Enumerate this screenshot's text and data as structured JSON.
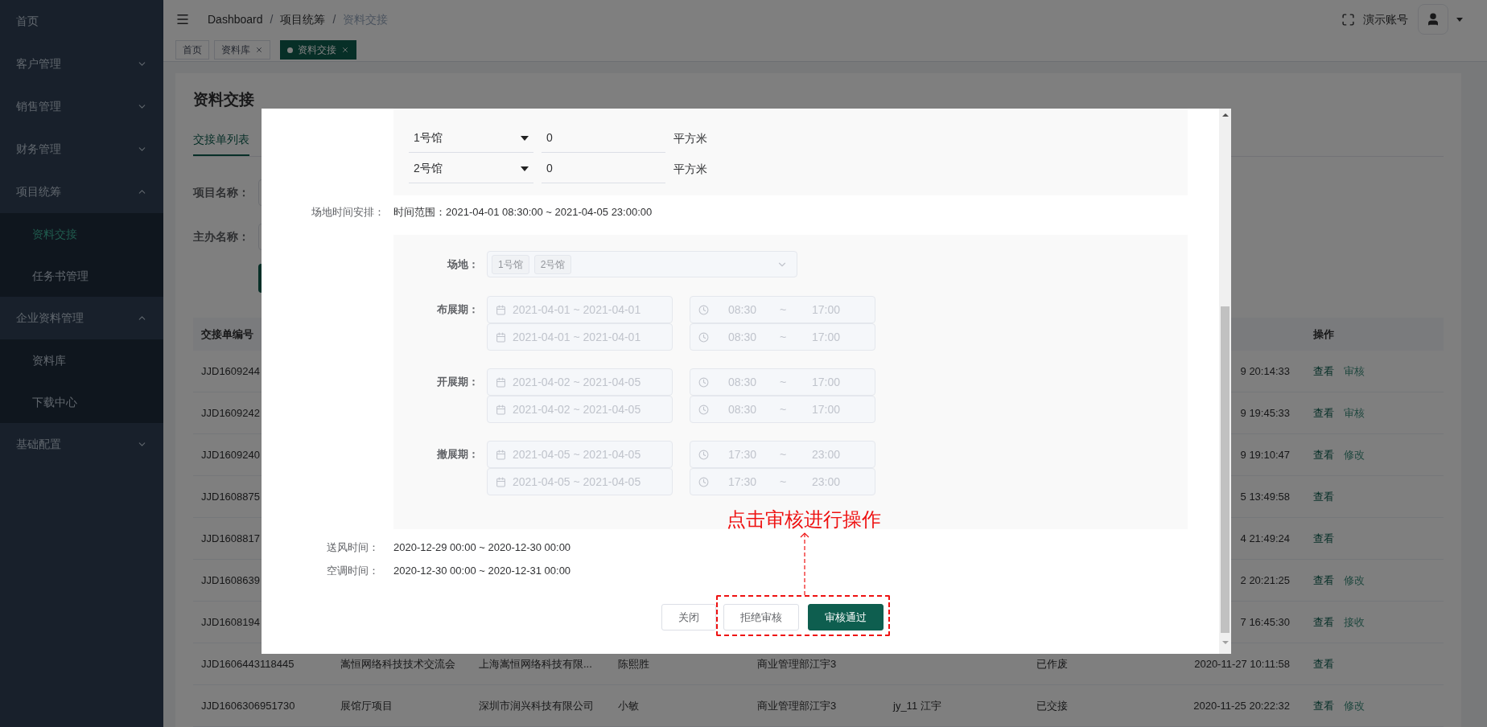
{
  "sidebar": {
    "items": [
      {
        "label": "首页",
        "kind": "link",
        "selected": false
      },
      {
        "label": "客户管理",
        "kind": "group",
        "expanded": false
      },
      {
        "label": "销售管理",
        "kind": "group",
        "expanded": false
      },
      {
        "label": "财务管理",
        "kind": "group",
        "expanded": false
      },
      {
        "label": "项目统筹",
        "kind": "group",
        "expanded": true,
        "children": [
          {
            "label": "资料交接",
            "selected": true
          },
          {
            "label": "任务书管理",
            "selected": false
          }
        ]
      },
      {
        "label": "企业资料管理",
        "kind": "group",
        "expanded": true,
        "children": [
          {
            "label": "资料库",
            "selected": false
          },
          {
            "label": "下载中心",
            "selected": false
          }
        ]
      },
      {
        "label": "基础配置",
        "kind": "group",
        "expanded": false
      }
    ]
  },
  "header": {
    "breadcrumb": [
      "Dashboard",
      "项目统筹",
      "资料交接"
    ],
    "separator": "/",
    "user": "演示账号"
  },
  "tags": [
    {
      "label": "首页",
      "closable": false,
      "selected": false
    },
    {
      "label": "资料库",
      "closable": true,
      "selected": false
    },
    {
      "label": "资料交接",
      "closable": true,
      "selected": true
    }
  ],
  "page": {
    "title": "资料交接",
    "tabs": [
      {
        "label": "交接单列表",
        "selected": true
      }
    ],
    "filters": [
      {
        "label": "项目名称："
      },
      {
        "label": "主办名称："
      }
    ]
  },
  "table": {
    "header": {
      "column_1": "交接单编号",
      "actions": "操作"
    },
    "rows": [
      {
        "column_1": "JJD1609244",
        "column_8": "9 20:14:33",
        "actions": [
          "查看",
          "审核"
        ]
      },
      {
        "column_1": "JJD1609242",
        "column_8": "9 19:45:33",
        "actions": [
          "查看",
          "审核"
        ]
      },
      {
        "column_1": "JJD1609240",
        "column_8": "9 19:10:47",
        "actions": [
          "查看",
          "修改"
        ]
      },
      {
        "column_1": "JJD1608875",
        "column_8": "5 13:49:58",
        "actions": [
          "查看"
        ]
      },
      {
        "column_1": "JJD1608817",
        "column_8": "4 21:49:24",
        "actions": [
          "查看"
        ]
      },
      {
        "column_1": "JJD1608639",
        "column_8": "2 20:21:25",
        "actions": [
          "查看",
          "修改"
        ]
      },
      {
        "column_1": "JJD1608194",
        "column_8": "7 16:45:30",
        "actions": [
          "查看",
          "接收"
        ]
      },
      {
        "column_1": "JJD1606443118445",
        "column_2": "嵩恒网络科技技术交流会",
        "column_3": "上海嵩恒网络科技有限...",
        "column_4": "陈熙胜",
        "column_5": "商业管理部江宇3",
        "column_7": "已作废",
        "column_8": "2020-11-27 10:11:58",
        "actions": [
          "查看"
        ]
      },
      {
        "column_1": "JJD1606306951730",
        "column_2": "展馆厅项目",
        "column_3": "深圳市润兴科技有限公司",
        "column_4": "小敏",
        "column_5": "商业管理部江宇3",
        "column_6": "jy_11 江宇",
        "column_7": "已交接",
        "column_8": "2020-11-25 20:22:32",
        "actions": [
          "查看",
          "修改"
        ]
      }
    ]
  },
  "modal": {
    "hall_areas": [
      {
        "hall": "1号馆",
        "area": "0",
        "unit": "平方米"
      },
      {
        "hall": "2号馆",
        "area": "0",
        "unit": "平方米"
      }
    ],
    "schedule": {
      "label": "场地时间安排：",
      "range": "时间范围：2021-04-01 08:30:00 ~ 2021-04-05 23:00:00"
    },
    "schedule_form": {
      "disabled": true,
      "venue": {
        "label": "场地：",
        "tags": [
          "1号馆",
          "2号馆"
        ]
      },
      "periods": [
        {
          "label": "布展期：",
          "rows": [
            {
              "dates": "2021-04-01 ~ 2021-04-01",
              "time_start": "08:30",
              "time_sep": "~",
              "time_end": "17:00"
            },
            {
              "dates": "2021-04-01 ~ 2021-04-01",
              "time_start": "08:30",
              "time_sep": "~",
              "time_end": "17:00"
            }
          ]
        },
        {
          "label": "开展期：",
          "rows": [
            {
              "dates": "2021-04-02 ~ 2021-04-05",
              "time_start": "08:30",
              "time_sep": "~",
              "time_end": "17:00"
            },
            {
              "dates": "2021-04-02 ~ 2021-04-05",
              "time_start": "08:30",
              "time_sep": "~",
              "time_end": "17:00"
            }
          ]
        },
        {
          "label": "撤展期：",
          "rows": [
            {
              "dates": "2021-04-05 ~ 2021-04-05",
              "time_start": "17:30",
              "time_sep": "~",
              "time_end": "23:00"
            },
            {
              "dates": "2021-04-05 ~ 2021-04-05",
              "time_start": "17:30",
              "time_sep": "~",
              "time_end": "23:00"
            }
          ]
        }
      ]
    },
    "fields": [
      {
        "label": "送风时间：",
        "value": "2020-12-29 00:00 ~ 2020-12-30 00:00"
      },
      {
        "label": "空调时间：",
        "value": "2020-12-30 00:00 ~ 2020-12-31 00:00"
      }
    ],
    "buttons": [
      {
        "label": "关闭",
        "kind": "default"
      },
      {
        "label": "拒绝审核",
        "kind": "default"
      },
      {
        "label": "审核通过",
        "kind": "primary"
      }
    ],
    "annotation": {
      "text": "点击审核进行操作"
    }
  }
}
